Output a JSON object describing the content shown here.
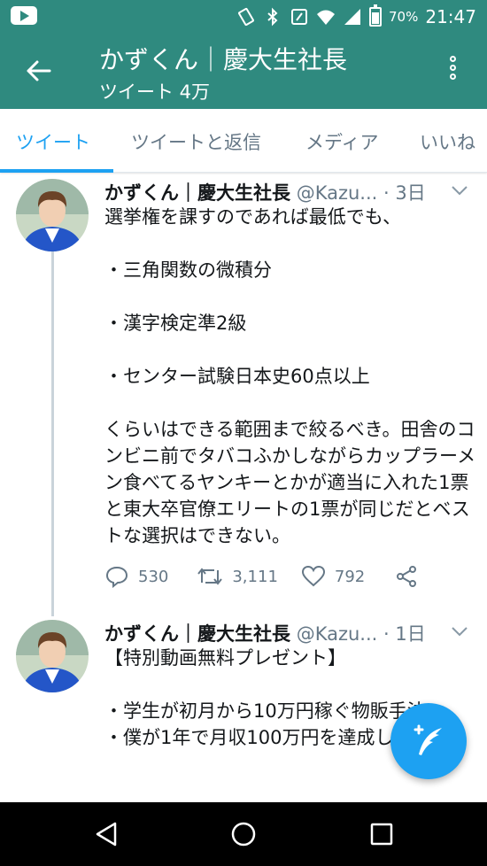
{
  "status_bar": {
    "battery_percent": "70%",
    "time": "21:47"
  },
  "app_bar": {
    "title": "かずくん｜慶大生社長",
    "subtitle": "ツイート 4万"
  },
  "tabs": [
    {
      "label": "ツイート",
      "active": true
    },
    {
      "label": "ツイートと返信",
      "active": false
    },
    {
      "label": "メディア",
      "active": false
    },
    {
      "label": "いいね",
      "active": false
    }
  ],
  "tweets": [
    {
      "name": "かずくん｜慶大生社長",
      "handle": "@Kazu...",
      "time": "· 3日",
      "text": "選挙権を課すのであれば最低でも、\n\n・三角関数の微積分\n\n・漢字検定準2級\n\n・センター試験日本史60点以上\n\nくらいはできる範囲まで絞るべき。田舎のコンビニ前でタバコふかしながらカップラーメン食べてるヤンキーとかが適当に入れた1票と東大卒官僚エリートの1票が同じだとベストな選択はできない。",
      "replies": "530",
      "retweets": "3,111",
      "likes": "792"
    },
    {
      "name": "かずくん｜慶大生社長",
      "handle": "@Kazu...",
      "time": "· 1日",
      "text": "【特別動画無料プレゼント】\n\n・学生が初月から10万円稼ぐ物販手法\n・僕が1年で月収100万円を達成した方法"
    }
  ],
  "colors": {
    "header": "#2f8a7f",
    "accent": "#1da1f2",
    "muted": "#657786"
  }
}
